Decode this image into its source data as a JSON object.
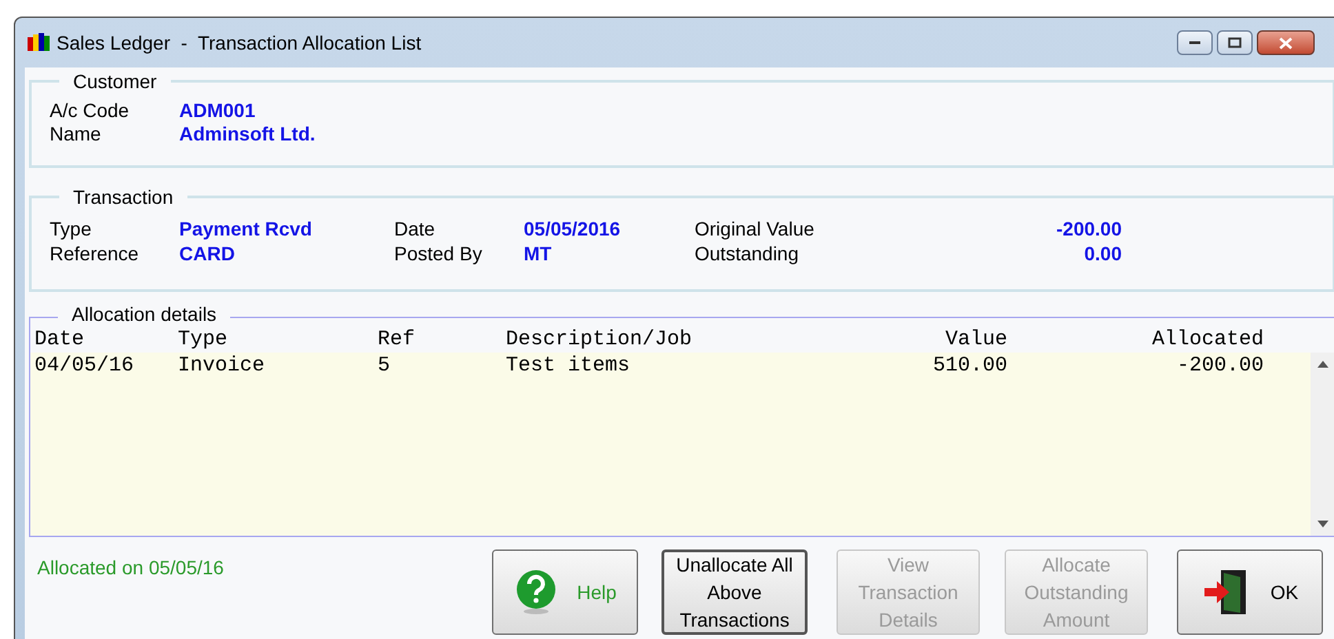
{
  "window": {
    "title": "Sales Ledger  -  Transaction Allocation List"
  },
  "customer": {
    "legend": "Customer",
    "fields": [
      {
        "label": "A/c Code",
        "value": "ADM001"
      },
      {
        "label": "Name",
        "value": "Adminsoft Ltd."
      }
    ]
  },
  "transaction": {
    "legend": "Transaction",
    "fields": [
      {
        "label": "Type",
        "value": "Payment Rcvd"
      },
      {
        "label": "Date",
        "value": "05/05/2016"
      },
      {
        "label": "Original Value",
        "value": "-200.00"
      },
      {
        "label": "Reference",
        "value": "CARD"
      },
      {
        "label": "Posted By",
        "value": "MT"
      },
      {
        "label": "Outstanding",
        "value": "0.00"
      }
    ]
  },
  "allocation": {
    "legend": "Allocation details",
    "columns": [
      "Date",
      "Type",
      "Ref",
      "Description/Job",
      "Value",
      "Allocated"
    ],
    "rows": [
      {
        "cells": [
          "04/05/16",
          "Invoice",
          "5",
          "Test items",
          "510.00",
          "-200.00"
        ]
      }
    ]
  },
  "status": "Allocated on 05/05/16",
  "buttons": [
    {
      "kind": "help",
      "label": "Help",
      "disabled": false,
      "focused": false
    },
    {
      "kind": "text",
      "label": "Unallocate All Above Transactions",
      "disabled": false,
      "focused": true
    },
    {
      "kind": "text",
      "label": "View Transaction Details",
      "disabled": true,
      "focused": false
    },
    {
      "kind": "text",
      "label": "Allocate Outstanding Amount",
      "disabled": true,
      "focused": false
    },
    {
      "kind": "ok",
      "label": "OK",
      "disabled": false,
      "focused": false
    }
  ]
}
